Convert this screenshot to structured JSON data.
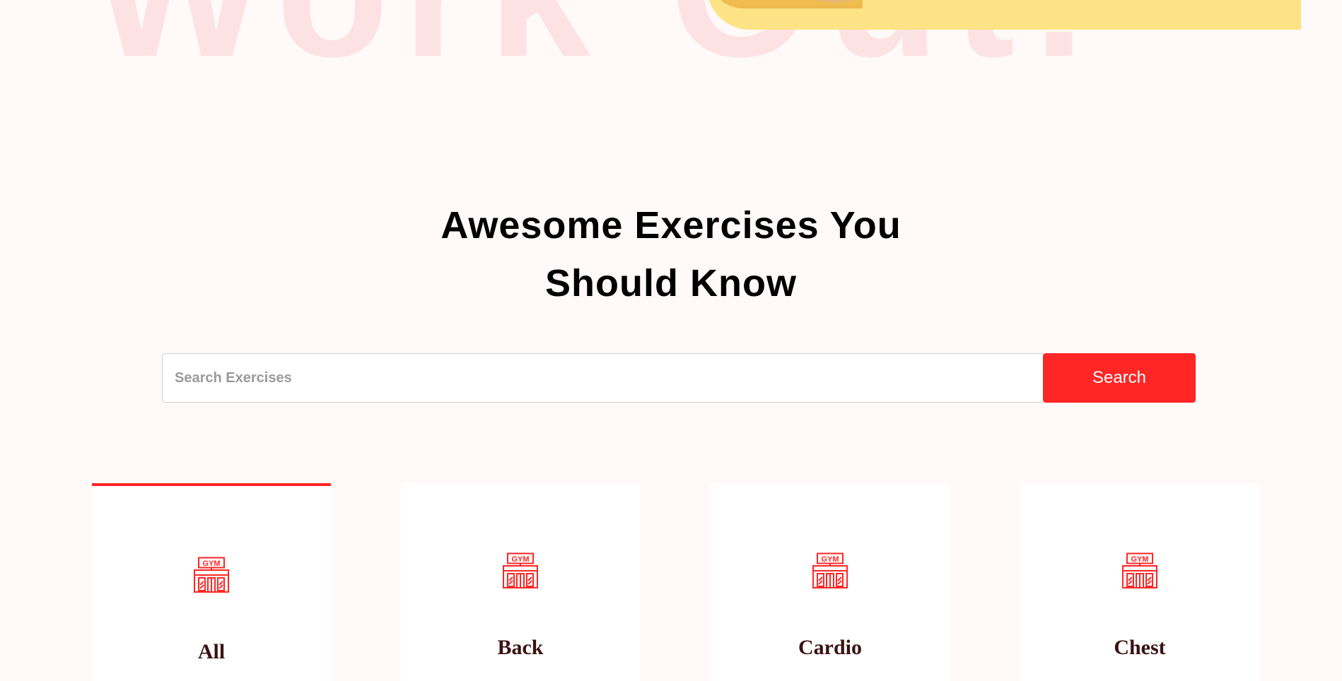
{
  "hero": {
    "watermark_text": "Work Out!",
    "banner_color": "#fde386"
  },
  "section": {
    "title_line1": "Awesome Exercises You",
    "title_line2": "Should Know"
  },
  "search": {
    "placeholder": "Search Exercises",
    "value": "",
    "button_label": "Search",
    "button_color": "#ff2625"
  },
  "categories": {
    "accent_color": "#ff2625",
    "icon": "gym-building-icon",
    "items": [
      {
        "label": "All",
        "active": true
      },
      {
        "label": "Back",
        "active": false
      },
      {
        "label": "Cardio",
        "active": false
      },
      {
        "label": "Chest",
        "active": false
      }
    ]
  }
}
